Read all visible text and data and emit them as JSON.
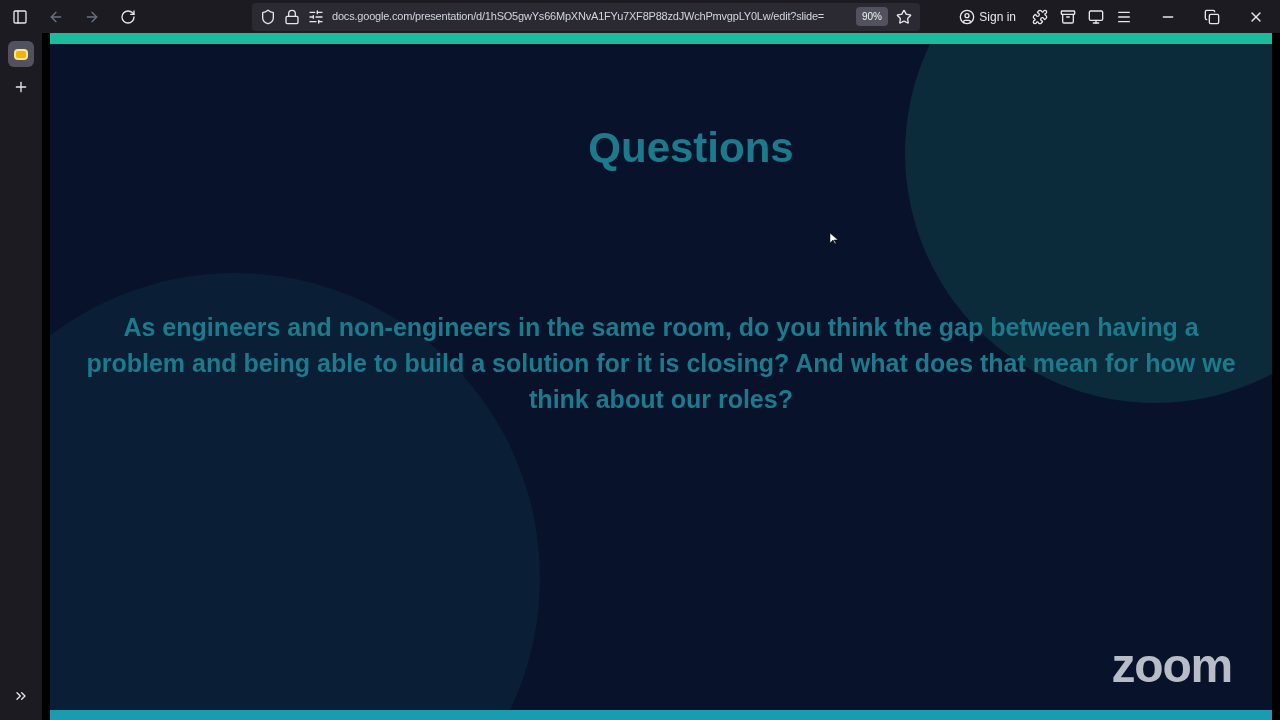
{
  "browser": {
    "url": "docs.google.com/presentation/d/1hSO5gwYs66MpXNvA1FYu7XF8P88zdJWchPmvgpLY0Lw/edit?slide=",
    "zoom": "90%",
    "sign_in": "Sign in"
  },
  "slide": {
    "title": "Questions",
    "body": "As engineers and non-engineers in the same room, do you think the gap between having a problem and being able to build a solution for it is closing? And what does that mean for how we think about our roles?",
    "logo": "zoom"
  }
}
